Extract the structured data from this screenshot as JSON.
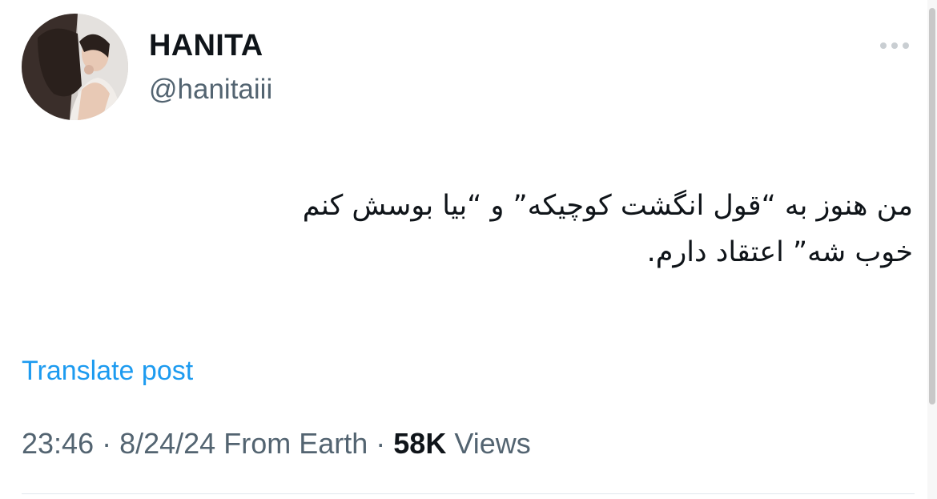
{
  "author": {
    "name": "HANITA",
    "handle": "@hanitaiii",
    "avatar_icon": "profile-photo"
  },
  "more_icon": "ellipsis-icon",
  "tweet": {
    "lines": [
      "من هنوز به “قول انگشت کوچیکه” و “بیا بوسش کنم",
      "خوب شه” اعتقاد دارم."
    ]
  },
  "translate_label": "Translate post",
  "meta": {
    "time": "23:46",
    "separator": " · ",
    "date": "8/24/24",
    "source": "From Earth",
    "views_count": "58K",
    "views_label": "Views"
  },
  "colors": {
    "link": "#1d9bf0",
    "secondary_text": "#536471",
    "primary_text": "#0f1419"
  }
}
